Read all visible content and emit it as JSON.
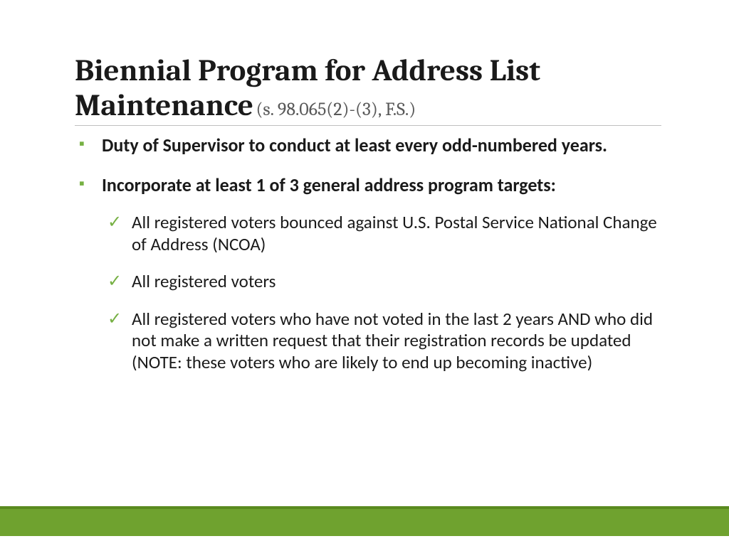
{
  "title": {
    "main": "Biennial Program for Address List Maintenance",
    "sub": "(s. 98.065(2)-(3), F.S.)"
  },
  "bullets": [
    {
      "text": "Duty of Supervisor to conduct at least every odd-numbered years.",
      "children": []
    },
    {
      "text": "Incorporate at least 1 of 3 general address program targets:",
      "children": [
        "All registered voters bounced against U.S. Postal Service National Change of Address (NCOA)",
        "All registered voters",
        "All registered voters who have not voted in the last 2 years AND who did not make a written request that their registration records be updated (NOTE: these voters who are likely to end up becoming inactive)"
      ]
    }
  ],
  "colors": {
    "accent": "#76b043",
    "footer": "#6fa22f"
  }
}
